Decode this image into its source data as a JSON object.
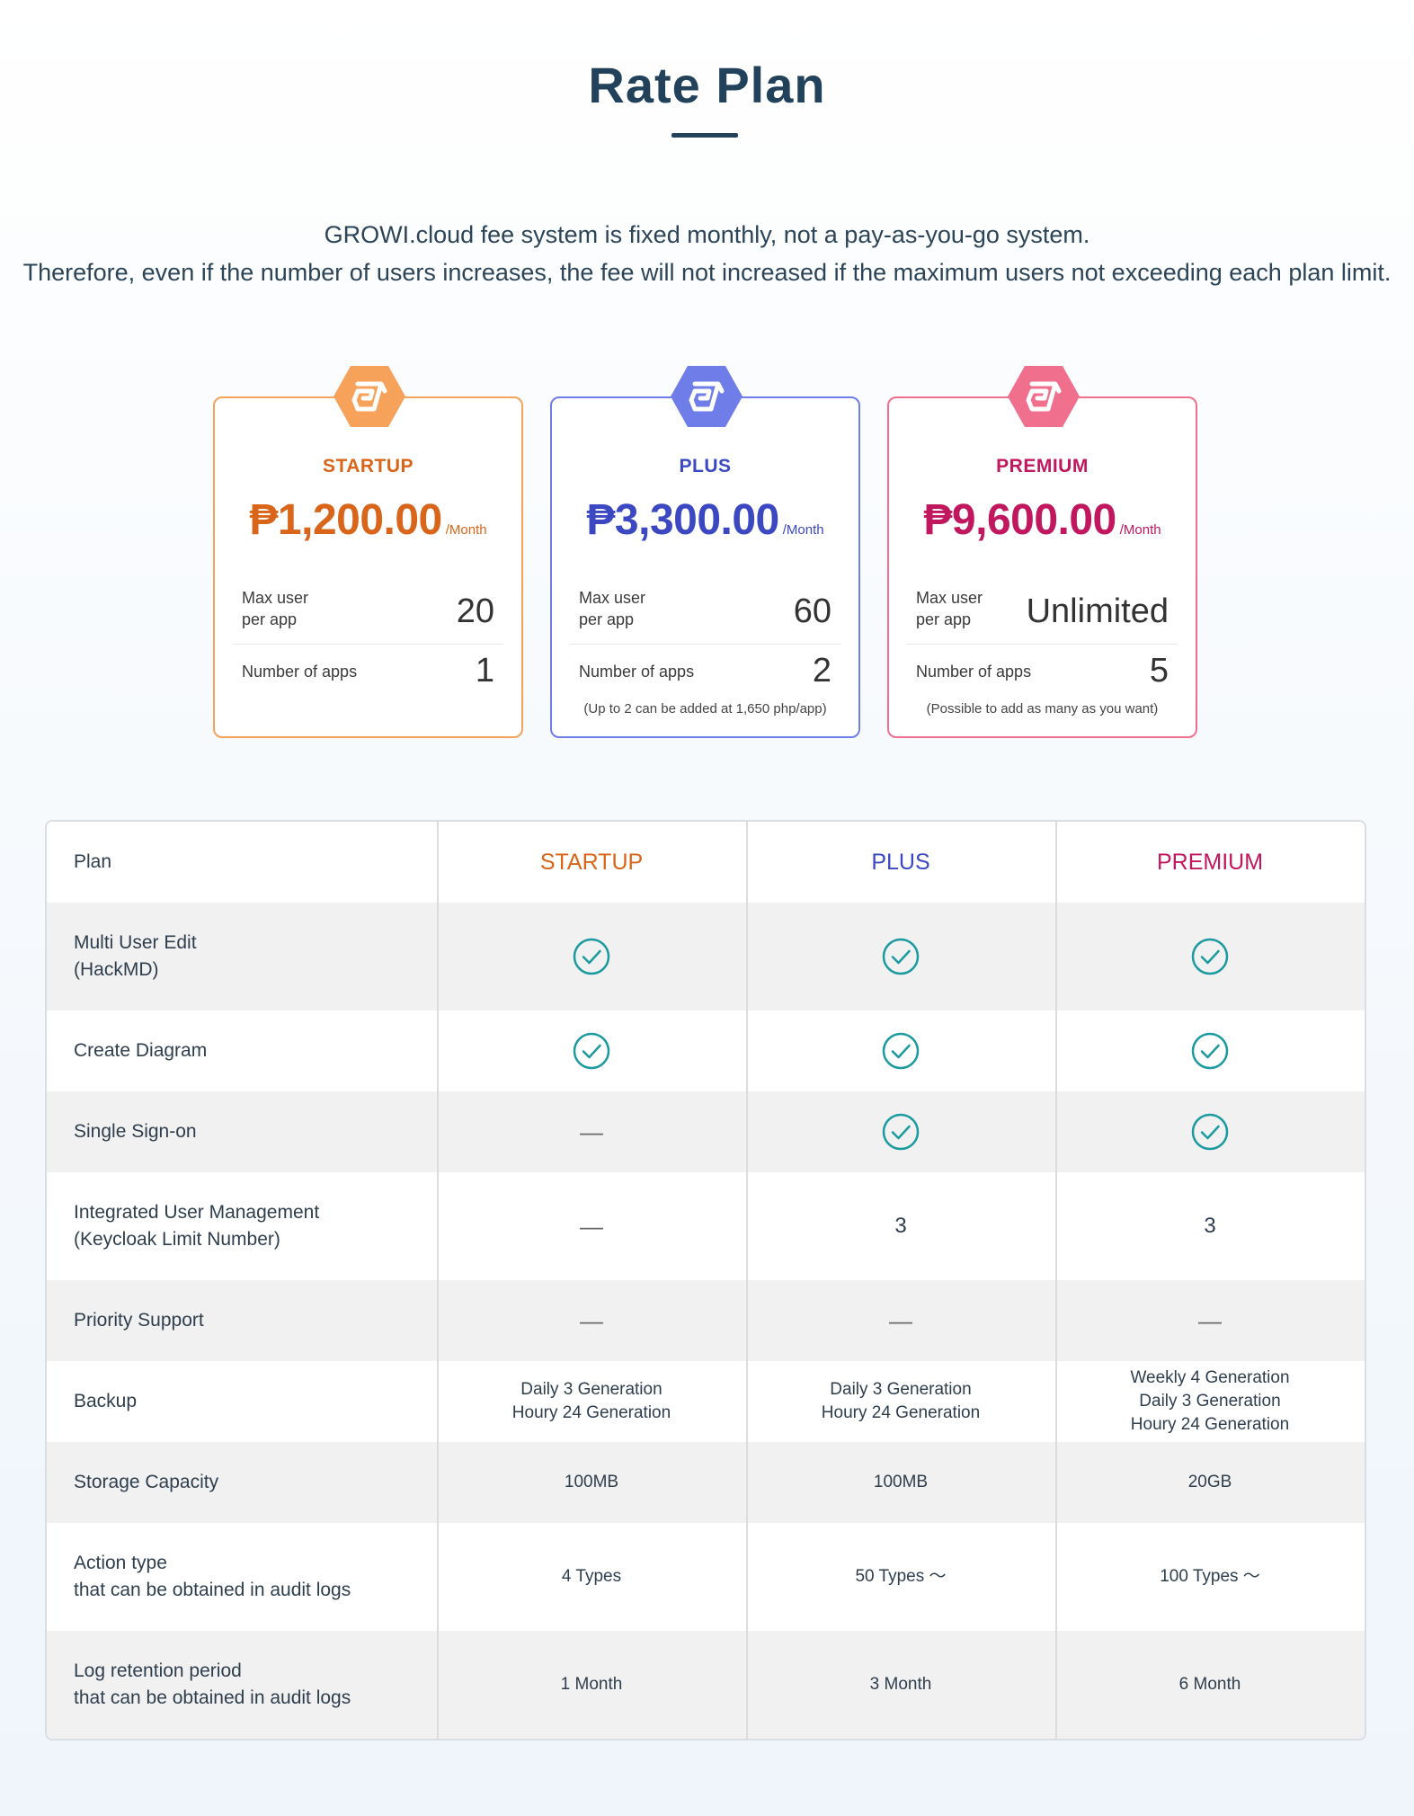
{
  "header": {
    "title": "Rate Plan",
    "intro_line1": "GROWI.cloud fee system is fixed monthly, not a pay-as-you-go system.",
    "intro_line2": "Therefore, even if the number of users increases, the fee will not increased if the maximum users not exceeding each plan limit."
  },
  "colors": {
    "startup": "#d8651a",
    "plus": "#3b48c2",
    "premium": "#c0175e",
    "check": "#1b9aa0"
  },
  "cards": [
    {
      "name": "STARTUP",
      "price": "₱1,200.00",
      "per": "/Month",
      "max_user_label": "Max user per app",
      "max_user_value": "20",
      "apps_label": "Number of apps",
      "apps_value": "1",
      "note": ""
    },
    {
      "name": "PLUS",
      "price": "₱3,300.00",
      "per": "/Month",
      "max_user_label": "Max user per app",
      "max_user_value": "60",
      "apps_label": "Number of apps",
      "apps_value": "2",
      "note": "(Up to 2 can be added at 1,650 php/app)"
    },
    {
      "name": "PREMIUM",
      "price": "₱9,600.00",
      "per": "/Month",
      "max_user_label": "Max user per app",
      "max_user_value": "Unlimited",
      "apps_label": "Number of apps",
      "apps_value": "5",
      "note": "(Possible to add as many as you want)"
    }
  ],
  "table": {
    "header": {
      "feature": "Plan",
      "startup": "STARTUP",
      "plus": "PLUS",
      "premium": "PREMIUM"
    },
    "rows": [
      {
        "feature": "Multi User Edit\n(HackMD)",
        "startup": "check",
        "plus": "check",
        "premium": "check"
      },
      {
        "feature": "Create Diagram",
        "startup": "check",
        "plus": "check",
        "premium": "check"
      },
      {
        "feature": "Single Sign-on",
        "startup": "—",
        "plus": "check",
        "premium": "check"
      },
      {
        "feature": "Integrated User Management\n(Keycloak Limit Number)",
        "startup": "—",
        "plus": "3",
        "premium": "3"
      },
      {
        "feature": "Priority Support",
        "startup": "—",
        "plus": "—",
        "premium": "—"
      },
      {
        "feature": "Backup",
        "startup": "Daily 3 Generation\nHoury 24 Generation",
        "plus": "Daily 3 Generation\nHoury 24 Generation",
        "premium": "Weekly 4 Generation\nDaily 3 Generation\nHoury 24 Generation"
      },
      {
        "feature": "Storage Capacity",
        "startup": "100MB",
        "plus": "100MB",
        "premium": "20GB"
      },
      {
        "feature": "Action type\nthat can be obtained in audit logs",
        "startup": "4 Types",
        "plus": "50 Types ～",
        "premium": "100 Types ～"
      },
      {
        "feature": "Log retention period\nthat can be obtained in audit logs",
        "startup": "1 Month",
        "plus": "3 Month",
        "premium": "6 Month"
      }
    ]
  }
}
